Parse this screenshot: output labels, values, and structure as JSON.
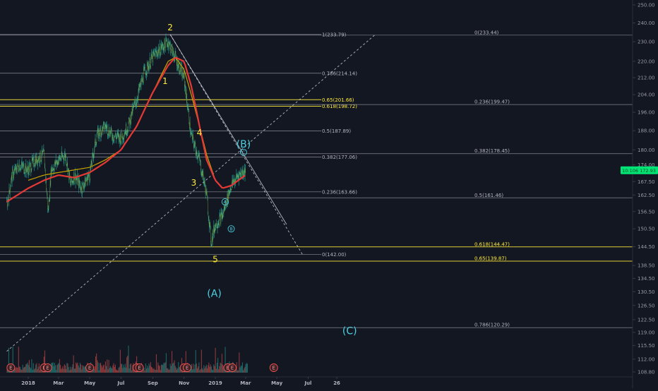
{
  "colors": {
    "background": "#131722",
    "price_line": "#26a69a",
    "ma_fast": "#c8a200",
    "ma_slow": "#e53935",
    "fib_white": "#9598a1",
    "fib_yellow": "#ffeb3b",
    "wave_yellow": "#ffeb3b",
    "wave_cyan": "#4dd0e1",
    "price_badge": "#00e676",
    "trend_line": "#d1d4dc",
    "volume_up": "#26a69a",
    "volume_down": "#ef5350"
  },
  "current_price_badge": "10:106 172.93",
  "chart_data": {
    "type": "line",
    "title": "",
    "xlabel": "",
    "ylabel": "",
    "ylim": [
      107,
      252
    ],
    "y_axis_scale": "log",
    "y_ticks": [
      "250.00",
      "240.00",
      "230.00",
      "220.00",
      "212.00",
      "204.00",
      "196.00",
      "188.00",
      "180.00",
      "174.00",
      "167.50",
      "162.50",
      "156.50",
      "150.50",
      "144.50",
      "138.50",
      "134.50",
      "130.50",
      "126.50",
      "122.50",
      "119.00",
      "115.50",
      "112.00",
      "108.80"
    ],
    "x_ticks": [
      "2018",
      "Mar",
      "May",
      "Jul",
      "Sep",
      "Nov",
      "2019",
      "Mar",
      "May",
      "Jul",
      "26"
    ],
    "series": [
      {
        "x": [
          "2017-11-20",
          "2017-12-01",
          "2017-12-15",
          "2018-01-01",
          "2018-01-15",
          "2018-02-01",
          "2018-02-09",
          "2018-02-15",
          "2018-03-01",
          "2018-03-15",
          "2018-03-25",
          "2018-04-01",
          "2018-04-15",
          "2018-05-01",
          "2018-05-15",
          "2018-06-01",
          "2018-06-15",
          "2018-07-01",
          "2018-07-15",
          "2018-08-01",
          "2018-08-15",
          "2018-09-01",
          "2018-09-15",
          "2018-10-01",
          "2018-10-15",
          "2018-11-01",
          "2018-11-15",
          "2018-12-01",
          "2018-12-15",
          "2018-12-24",
          "2019-01-01",
          "2019-01-15",
          "2019-02-01",
          "2019-02-15",
          "2019-03-01"
        ],
        "values": [
          158,
          170,
          174,
          172,
          176,
          178,
          156,
          172,
          176,
          178,
          166,
          170,
          165,
          170,
          186,
          190,
          186,
          185,
          190,
          202,
          214,
          222,
          226,
          230,
          222,
          212,
          186,
          176,
          163,
          146,
          152,
          155,
          166,
          170,
          172
        ]
      },
      {
        "name": "",
        "x": [
          "2018-01-01",
          "2018-02-01",
          "2018-03-01",
          "2018-04-01",
          "2018-05-01",
          "2018-06-01",
          "2018-07-01",
          "2018-08-01",
          "2018-09-01",
          "2018-10-01",
          "2018-10-15",
          "2018-11-01",
          "2018-11-15",
          "2018-12-01",
          "2018-12-15",
          "2019-01-01",
          "2019-01-15",
          "2019-02-01",
          "2019-03-01"
        ],
        "values": [
          168,
          170,
          171,
          172,
          173,
          176,
          180,
          190,
          205,
          220,
          222,
          216,
          204,
          190,
          178,
          168,
          165,
          166,
          170
        ]
      },
      {
        "name": "",
        "x": [
          "2017-11-20",
          "2018-01-01",
          "2018-02-01",
          "2018-03-01",
          "2018-04-01",
          "2018-05-01",
          "2018-06-01",
          "2018-07-01",
          "2018-08-01",
          "2018-09-01",
          "2018-10-01",
          "2018-10-15",
          "2018-11-01",
          "2018-11-15",
          "2018-12-01",
          "2018-12-15",
          "2019-01-01",
          "2019-01-15",
          "2019-02-01",
          "2019-03-01"
        ],
        "values": [
          160,
          165,
          168,
          170,
          169,
          171,
          175,
          180,
          190,
          205,
          218,
          222,
          220,
          208,
          190,
          176,
          168,
          165,
          166,
          170
        ]
      }
    ],
    "fib_levels_left": [
      {
        "label": "1(233.79)",
        "value": 233.79,
        "color": "white"
      },
      {
        "label": "0.786(214.14)",
        "value": 214.14,
        "color": "white"
      },
      {
        "label": "0.65(201.66)",
        "value": 201.66,
        "color": "yellow"
      },
      {
        "label": "0.618(198.72)",
        "value": 198.72,
        "color": "yellow"
      },
      {
        "label": "0.5(187.89)",
        "value": 187.89,
        "color": "white"
      },
      {
        "label": "0.382(177.06)",
        "value": 177.06,
        "color": "white"
      },
      {
        "label": "0.236(163.66)",
        "value": 163.66,
        "color": "white"
      },
      {
        "label": "0(142.00)",
        "value": 142.0,
        "color": "white"
      }
    ],
    "fib_levels_right": [
      {
        "label": "0(233.44)",
        "value": 233.44,
        "color": "white"
      },
      {
        "label": "0.236(199.47)",
        "value": 199.47,
        "color": "white"
      },
      {
        "label": "0.382(178.45)",
        "value": 178.45,
        "color": "white"
      },
      {
        "label": "0.5(161.46)",
        "value": 161.46,
        "color": "white"
      },
      {
        "label": "0.618(144.47)",
        "value": 144.47,
        "color": "yellow"
      },
      {
        "label": "0.65(139.87)",
        "value": 139.87,
        "color": "yellow"
      },
      {
        "label": "0.786(120.29)",
        "value": 120.29,
        "color": "white"
      }
    ],
    "wave_labels": [
      {
        "text": "1",
        "date": "2018-09-25",
        "value": 209,
        "color": "yellow"
      },
      {
        "text": "2",
        "date": "2018-10-05",
        "value": 236,
        "color": "yellow"
      },
      {
        "text": "3",
        "date": "2018-11-20",
        "value": 166,
        "color": "yellow"
      },
      {
        "text": "4",
        "date": "2018-12-01",
        "value": 186,
        "color": "yellow"
      },
      {
        "text": "5",
        "date": "2019-01-01",
        "value": 139.5,
        "color": "yellow"
      },
      {
        "text": "(A)",
        "date": "2018-12-30",
        "value": 129,
        "color": "cyan"
      },
      {
        "text": "(B)",
        "date": "2019-02-25",
        "value": 181,
        "color": "cyan"
      },
      {
        "text": "(C)",
        "date": "2019-09-20",
        "value": 118.5,
        "color": "cyan"
      }
    ],
    "circle_labels": [
      {
        "text": "A",
        "date": "2019-01-20",
        "value": 160
      },
      {
        "text": "B",
        "date": "2019-02-01",
        "value": 150.5
      },
      {
        "text": "C",
        "date": "2019-02-25",
        "value": 179
      }
    ],
    "earnings_markers": {
      "text": "E",
      "dates": [
        "2017-11-28",
        "2018-02-01",
        "2018-02-08",
        "2018-05-01",
        "2018-08-01",
        "2018-08-06",
        "2018-11-01",
        "2018-11-07",
        "2019-01-25",
        "2019-02-03",
        "2019-04-25"
      ]
    },
    "trend_lines": [
      {
        "from": [
          "2018-10-05",
          233.79
        ],
        "to": [
          "2019-05-20",
          152
        ],
        "style": "solid"
      },
      {
        "from": [
          "2018-10-05",
          233.79
        ],
        "to": [
          "2019-06-20",
          142
        ],
        "style": "dashed"
      },
      {
        "from": [
          "2017-11-20",
          114
        ],
        "to": [
          "2019-11-10",
          234
        ],
        "style": "dashed"
      }
    ]
  }
}
